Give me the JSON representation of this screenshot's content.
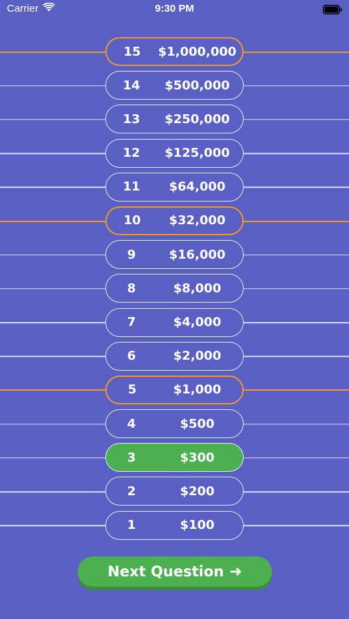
{
  "status_bar": {
    "carrier": "Carrier",
    "time": "9:30 PM"
  },
  "ladder": [
    {
      "level": "15",
      "amount": "$1,000,000",
      "milestone": true,
      "current": false
    },
    {
      "level": "14",
      "amount": "$500,000",
      "milestone": false,
      "current": false
    },
    {
      "level": "13",
      "amount": "$250,000",
      "milestone": false,
      "current": false
    },
    {
      "level": "12",
      "amount": "$125,000",
      "milestone": false,
      "current": false
    },
    {
      "level": "11",
      "amount": "$64,000",
      "milestone": false,
      "current": false
    },
    {
      "level": "10",
      "amount": "$32,000",
      "milestone": true,
      "current": false
    },
    {
      "level": "9",
      "amount": "$16,000",
      "milestone": false,
      "current": false
    },
    {
      "level": "8",
      "amount": "$8,000",
      "milestone": false,
      "current": false
    },
    {
      "level": "7",
      "amount": "$4,000",
      "milestone": false,
      "current": false
    },
    {
      "level": "6",
      "amount": "$2,000",
      "milestone": false,
      "current": false
    },
    {
      "level": "5",
      "amount": "$1,000",
      "milestone": true,
      "current": false
    },
    {
      "level": "4",
      "amount": "$500",
      "milestone": false,
      "current": false
    },
    {
      "level": "3",
      "amount": "$300",
      "milestone": false,
      "current": true
    },
    {
      "level": "2",
      "amount": "$200",
      "milestone": false,
      "current": false
    },
    {
      "level": "1",
      "amount": "$100",
      "milestone": false,
      "current": false
    }
  ],
  "next_button": {
    "label": "Next Question",
    "icon": "arrow-right-icon"
  },
  "colors": {
    "background": "#5a5fc4",
    "milestone": "#f0962a",
    "current": "#4caf50"
  }
}
